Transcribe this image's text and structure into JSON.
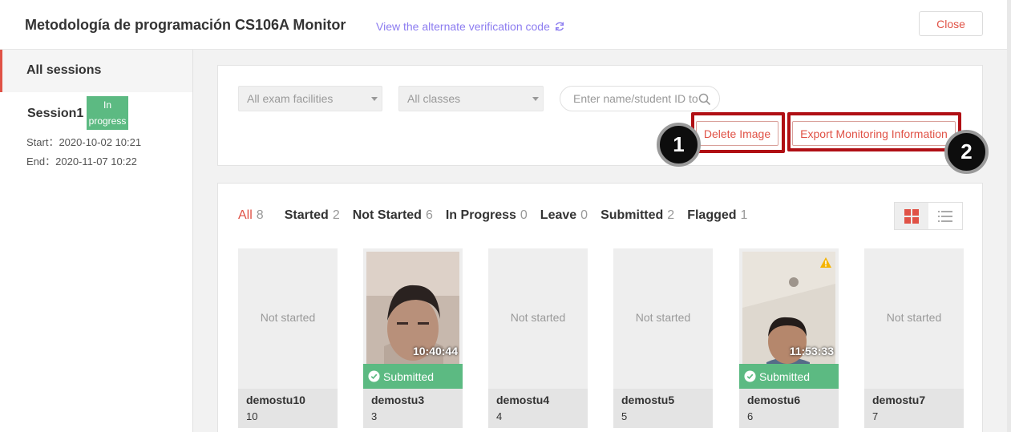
{
  "header": {
    "title": "Metodología de programación CS106A  Monitor",
    "alt_code_link": "View the alternate verification code",
    "close_label": "Close"
  },
  "sidebar": {
    "all_sessions": "All sessions",
    "session": {
      "name": "Session1",
      "status": "In progress",
      "start": "Start：2020-10-02 10:21",
      "end": "End：2020-11-07 10:22"
    }
  },
  "filters": {
    "facility_select": "All exam facilities",
    "class_select": "All classes",
    "search_placeholder": "Enter name/student ID to",
    "delete_label": "Delete Image",
    "export_label": "Export Monitoring Information"
  },
  "callouts": [
    "1",
    "2"
  ],
  "tabs": [
    {
      "label": "All",
      "count": "8"
    },
    {
      "label": "Started",
      "count": "2"
    },
    {
      "label": "Not Started",
      "count": "6"
    },
    {
      "label": "In Progress",
      "count": "0"
    },
    {
      "label": "Leave",
      "count": "0"
    },
    {
      "label": "Submitted",
      "count": "2"
    },
    {
      "label": "Flagged",
      "count": "1"
    }
  ],
  "students": [
    {
      "username": "demostu10",
      "id": "10",
      "state": "Not started"
    },
    {
      "username": "demostu3",
      "id": "3",
      "time": "10:40:44",
      "status": "Submitted"
    },
    {
      "username": "demostu4",
      "id": "4",
      "state": "Not started"
    },
    {
      "username": "demostu5",
      "id": "5",
      "state": "Not started"
    },
    {
      "username": "demostu6",
      "id": "6",
      "time": "11:53:33",
      "status": "Submitted"
    },
    {
      "username": "demostu7",
      "id": "7",
      "state": "Not started"
    }
  ],
  "colors": {
    "accent": "#e05246",
    "link": "#8c7cf0",
    "success": "#5cba82",
    "callout_border": "#b00f14"
  }
}
